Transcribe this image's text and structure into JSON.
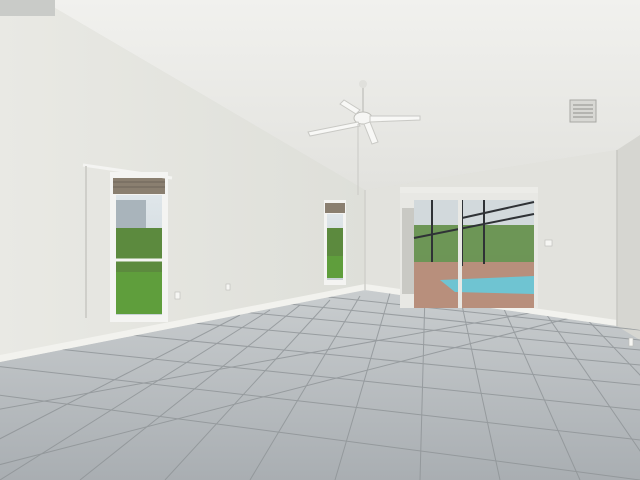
{
  "scene": {
    "colors": {
      "ceiling": "#eaeae6",
      "wall_left": "#e6e6e1",
      "wall_back": "#e1e1dc",
      "wall_right": "#d9d9d4",
      "floor": "#b4b9bc",
      "grout": "#8e9396",
      "baseboard": "#f2f2ee",
      "window_frame": "#f4f4f2",
      "lawn": "#5f9e3c",
      "pool_water": "#6fc4d2",
      "pool_deck": "#b88f7c",
      "foliage": "#5c8a3e"
    },
    "icons": [
      "ceiling-fan-icon",
      "air-vent-icon",
      "outlet-icon",
      "light-switch-icon"
    ]
  }
}
